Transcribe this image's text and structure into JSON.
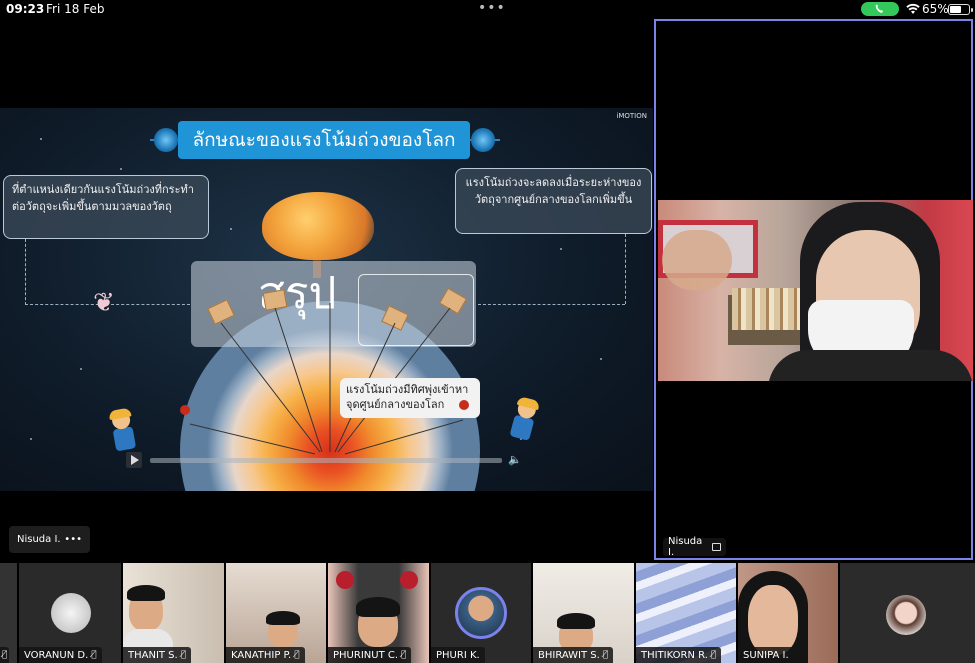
{
  "status_bar": {
    "time": "09:23",
    "date": "Fri 18 Feb",
    "battery": "65%",
    "battery_level": 0.65,
    "call_icon": "phone-icon",
    "wifi_icon": "wifi-icon"
  },
  "slide": {
    "brand": "iMOTION",
    "title": "ลักษณะของแรงโน้มถ่วงของโลก",
    "note_left": "ที่ตำแหน่งเดียวกันแรงโน้มถ่วงที่กระทำต่อวัตถุจะเพิ่มขึ้นตามมวลของวัตถุ",
    "note_right": "แรงโน้มถ่วงจะลดลงเมื่อระยะห่างของวัตถุจากศูนย์กลางของโลกเพิ่มขึ้น",
    "overlay_word": "สรุป",
    "bubble_text": "แรงโน้มถ่วงมีทิศพุ่งเข้าหาจุดศูนย์กลางของโลก",
    "core_label": "จุดศูนย์กลางโลก"
  },
  "presenter": {
    "name": "Nisuda I.",
    "more": "•••"
  },
  "speaker": {
    "name": "Nisuda I.",
    "border_color": "#7b83eb"
  },
  "gallery": [
    {
      "name": "",
      "muted": true
    },
    {
      "name": "VORANUN D.",
      "muted": true
    },
    {
      "name": "THANIT S.",
      "muted": true
    },
    {
      "name": "KANATHIP P.",
      "muted": true
    },
    {
      "name": "PHURINUT C.",
      "muted": true
    },
    {
      "name": "PHURI K.",
      "muted": false
    },
    {
      "name": "BHIRAWIT S.",
      "muted": true
    },
    {
      "name": "THITIKORN R.",
      "muted": true
    },
    {
      "name": "SUNIPA I.",
      "muted": false
    },
    {
      "name": "",
      "muted": false
    }
  ]
}
